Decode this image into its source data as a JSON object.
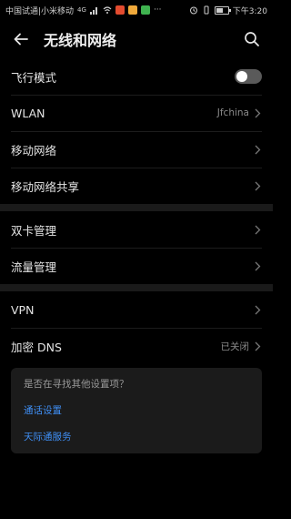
{
  "status_bar": {
    "carrier": "中国试通|小米移动",
    "signal_label": "4G",
    "time": "下午3:20",
    "battery_level": 0.6,
    "notification_colors": [
      "#e34b2f",
      "#f0a93b",
      "#3fb34f"
    ]
  },
  "header": {
    "back_icon": "arrow-left-icon",
    "title": "无线和网络",
    "search_icon": "search-icon"
  },
  "groups": [
    {
      "items": [
        {
          "label": "飞行模式",
          "type": "toggle",
          "on": false
        },
        {
          "label": "WLAN",
          "value": "Jfchina",
          "type": "link"
        },
        {
          "label": "移动网络",
          "type": "link"
        },
        {
          "label": "移动网络共享",
          "type": "link"
        }
      ]
    },
    {
      "items": [
        {
          "label": "双卡管理",
          "type": "link"
        },
        {
          "label": "流量管理",
          "type": "link"
        }
      ]
    },
    {
      "items": [
        {
          "label": "VPN",
          "type": "link"
        },
        {
          "label": "加密 DNS",
          "value": "已关闭",
          "type": "link"
        }
      ]
    }
  ],
  "suggestions": {
    "title": "是否在寻找其他设置项？",
    "links": [
      "通话设置",
      "天际通服务"
    ]
  },
  "colors": {
    "background": "#000000",
    "card": "#1b1b1b",
    "link": "#3f8ff5",
    "divider": "#1a1a1a"
  }
}
